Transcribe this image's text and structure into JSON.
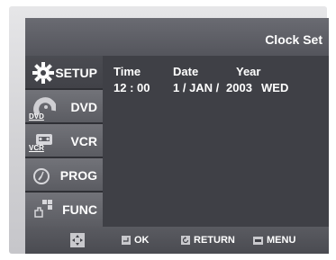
{
  "header": {
    "title": "Clock Set"
  },
  "sidebar": {
    "items": [
      {
        "label": "SETUP",
        "active": true,
        "icon": "gear-icon"
      },
      {
        "label": "DVD",
        "active": false,
        "icon": "dvd-disc-icon",
        "tag": "DVD"
      },
      {
        "label": "VCR",
        "active": false,
        "icon": "vcr-cassette-icon",
        "tag": "VCR"
      },
      {
        "label": "PROG",
        "active": false,
        "icon": "clock-icon"
      },
      {
        "label": "FUNC",
        "active": false,
        "icon": "hand-grid-icon"
      }
    ]
  },
  "clock": {
    "headers": {
      "time": "Time",
      "date": "Date",
      "year": "Year"
    },
    "values": {
      "time": "12 : 00",
      "date": "1 / JAN /",
      "year": "2003",
      "weekday": "WED"
    }
  },
  "footer": {
    "nav_icon": "dpad-icon",
    "ok_label": "OK",
    "return_label": "RETURN",
    "menu_label": "MENU"
  },
  "colors": {
    "panel": "#3f4046",
    "header": "#5e5f66",
    "frame": "#d6d6d9",
    "text": "#ffffff"
  }
}
